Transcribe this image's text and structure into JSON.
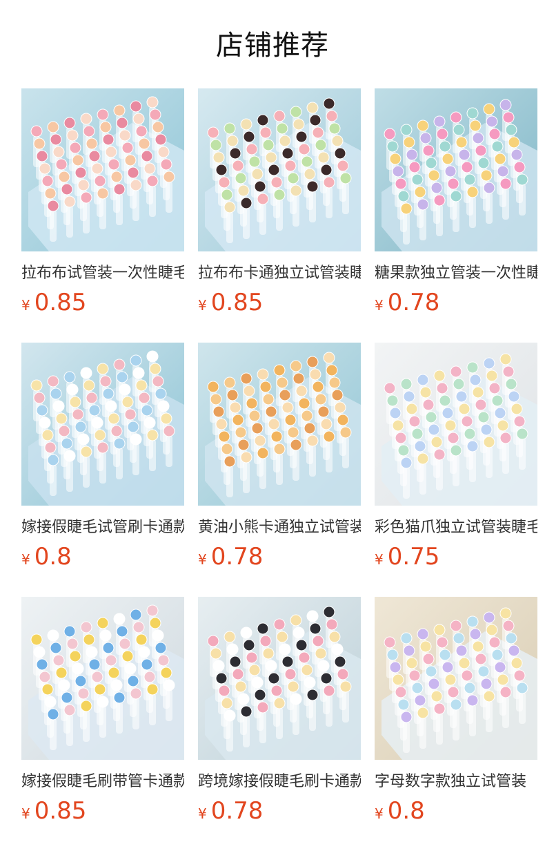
{
  "section": {
    "title": "店铺推荐"
  },
  "colors": {
    "price": "#e2461f",
    "title": "#111111"
  },
  "products": [
    {
      "name": "拉布布试管装一次性睫毛刷",
      "currency": "¥",
      "price": "0.85",
      "image": "pink-cartoon-tubes-photo",
      "theme": {
        "bg": "#8fc5d6",
        "bg2": "#c9e3ec",
        "cap": [
          "#f4a9b8",
          "#f7c7a3",
          "#e98aa0",
          "#f9d9c8"
        ],
        "tray": "#cfe6f2"
      }
    },
    {
      "name": "拉布布卡通独立试管装睫毛刷",
      "currency": "¥",
      "price": "0.85",
      "image": "bunny-cartoon-tubes-photo",
      "theme": {
        "bg": "#9cc9d8",
        "bg2": "#d6e9f0",
        "cap": [
          "#f6b0b7",
          "#bfe2a6",
          "#f3e1b3",
          "#3b2a2a"
        ],
        "tray": "#d4e8f3"
      }
    },
    {
      "name": "糖果款独立管装一次性睫毛刷",
      "currency": "¥",
      "price": "0.78",
      "image": "candy-flower-tubes-photo",
      "theme": {
        "bg": "#7fb6c6",
        "bg2": "#bfdde6",
        "cap": [
          "#f59ac0",
          "#9fd8d2",
          "#f7d27a",
          "#c7b4ea"
        ],
        "tray": "#cde3ee"
      }
    },
    {
      "name": "嫁接假睫毛试管刷卡通款",
      "currency": "¥",
      "price": "0.8",
      "image": "mixed-cartoon-tubes-photo",
      "theme": {
        "bg": "#8cc3d4",
        "bg2": "#d2e6ee",
        "cap": [
          "#f7e3a8",
          "#f3b8c2",
          "#a9d3ee",
          "#ffffff"
        ],
        "tray": "#c8e0ee"
      }
    },
    {
      "name": "黄油小熊卡通独立试管装",
      "currency": "¥",
      "price": "0.78",
      "image": "butter-bear-tubes-photo",
      "theme": {
        "bg": "#93c6d5",
        "bg2": "#cfe5ec",
        "cap": [
          "#f2b45e",
          "#f6c98a",
          "#e89f5a",
          "#f9dcb0"
        ],
        "tray": "#cfe4ee"
      }
    },
    {
      "name": "彩色猫爪独立试管装睫毛刷",
      "currency": "¥",
      "price": "0.75",
      "image": "cat-paw-tubes-photo",
      "theme": {
        "bg": "#dfe3e6",
        "bg2": "#f2f4f5",
        "cap": [
          "#f3b3c6",
          "#b9e3c9",
          "#bcd3f4",
          "#f6e3a5"
        ],
        "tray": "#e3eef5"
      }
    },
    {
      "name": "嫁接假睫毛刷带管卡通款",
      "currency": "¥",
      "price": "0.85",
      "image": "yellow-duck-tubes-photo",
      "theme": {
        "bg": "#cfd9df",
        "bg2": "#eef2f4",
        "cap": [
          "#f4d35c",
          "#ffffff",
          "#6fb0e6",
          "#f3c6d0"
        ],
        "tray": "#dde9f2"
      }
    },
    {
      "name": "跨境嫁接假睫毛刷卡通款",
      "currency": "¥",
      "price": "0.78",
      "image": "pink-pig-tubes-photo",
      "theme": {
        "bg": "#bcd0d8",
        "bg2": "#e7eef1",
        "cap": [
          "#f3a9bb",
          "#f7e0a8",
          "#ffffff",
          "#2d2d33"
        ],
        "tray": "#d9e7ef"
      }
    },
    {
      "name": "字母数字款独立试管装",
      "currency": "¥",
      "price": "0.8",
      "image": "letter-number-tubes-photo",
      "theme": {
        "bg": "#d9cdb4",
        "bg2": "#efe7d6",
        "cap": [
          "#f5b3c5",
          "#b9dff0",
          "#c9b6ef",
          "#f7e3a3"
        ],
        "tray": "#e6eef3"
      }
    }
  ]
}
